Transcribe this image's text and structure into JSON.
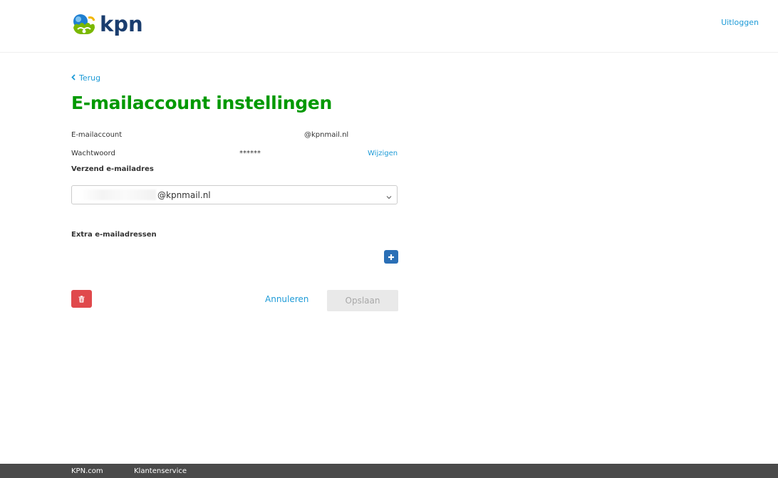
{
  "header": {
    "logo_text": "kpn",
    "logout_label": "Uitloggen"
  },
  "nav": {
    "back_label": "Terug"
  },
  "page_title": "E-mailaccount instellingen",
  "account": {
    "email_label": "E-mailaccount",
    "email_value": "@kpnmail.nl",
    "password_label": "Wachtwoord",
    "password_value": "******",
    "change_label": "Wijzigen"
  },
  "sender": {
    "label": "Verzend e-mailadres",
    "selected_value": "@kpnmail.nl"
  },
  "extra": {
    "label": "Extra e-mailadressen"
  },
  "actions": {
    "cancel_label": "Annuleren",
    "save_label": "Opslaan"
  },
  "footer": {
    "links": [
      "KPN.com",
      "Klantenservice"
    ]
  },
  "colors": {
    "brand_green": "#009900",
    "link_blue": "#1e9bd7",
    "add_button": "#2a6fb6",
    "delete_button": "#e0494c",
    "footer_bg": "#4a4a4a"
  },
  "icons": [
    "kpn-logo-icon",
    "chevron-left-icon",
    "chevron-down-icon",
    "plus-icon",
    "trash-icon"
  ]
}
